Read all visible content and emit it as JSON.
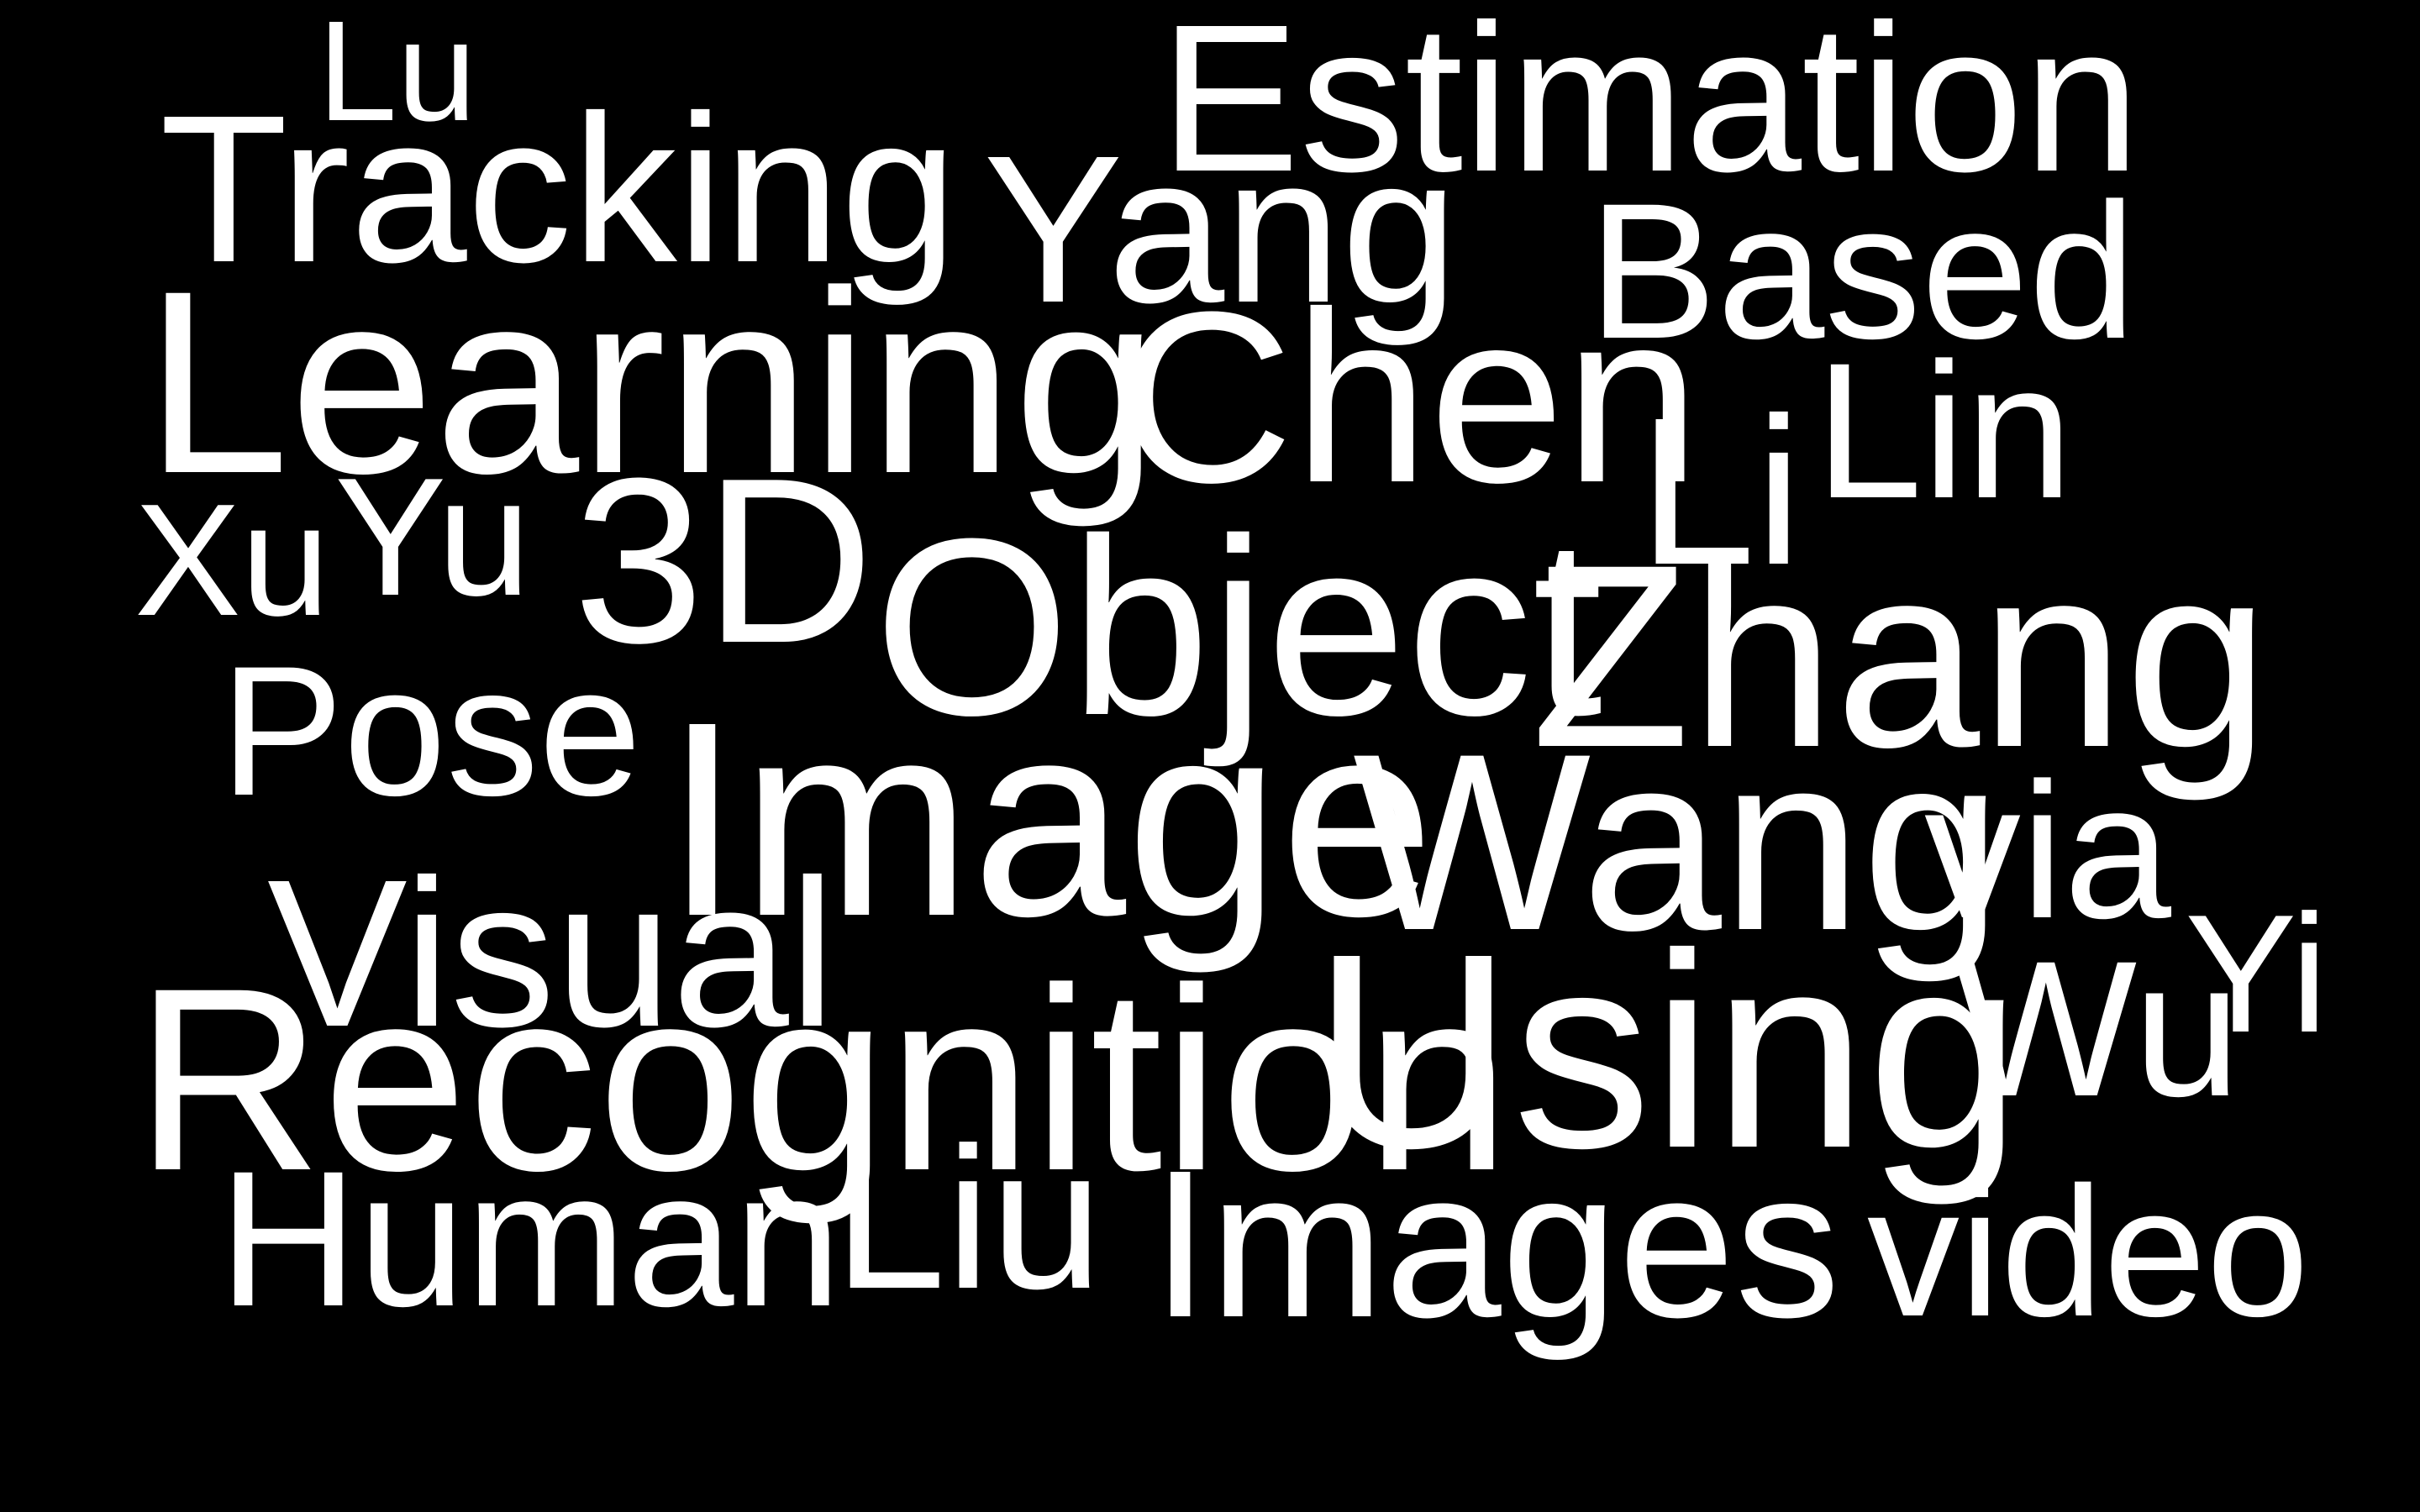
{
  "background_color": "#000000",
  "text_color": "#ffffff",
  "words": [
    {
      "id": "lu",
      "text": "Lu"
    },
    {
      "id": "estimation",
      "text": "Estimation"
    },
    {
      "id": "tracking",
      "text": "Tracking"
    },
    {
      "id": "yang",
      "text": "Yang"
    },
    {
      "id": "based",
      "text": "Based"
    },
    {
      "id": "learning",
      "text": "Learning"
    },
    {
      "id": "chen",
      "text": "Chen"
    },
    {
      "id": "li",
      "text": "Li"
    },
    {
      "id": "lin",
      "text": "Lin"
    },
    {
      "id": "xu",
      "text": "Xu"
    },
    {
      "id": "yu",
      "text": "Yu"
    },
    {
      "id": "3d",
      "text": "3D"
    },
    {
      "id": "object",
      "text": "Object"
    },
    {
      "id": "zhang",
      "text": "Zhang"
    },
    {
      "id": "pose",
      "text": "Pose"
    },
    {
      "id": "image",
      "text": "Image"
    },
    {
      "id": "wang",
      "text": "Wang"
    },
    {
      "id": "via",
      "text": "via"
    },
    {
      "id": "visual",
      "text": "Visual"
    },
    {
      "id": "yi",
      "text": "Yi"
    },
    {
      "id": "recognition",
      "text": "Recognition"
    },
    {
      "id": "using",
      "text": "Using"
    },
    {
      "id": "wu",
      "text": "Wu"
    },
    {
      "id": "human",
      "text": "Human"
    },
    {
      "id": "liu",
      "text": "Liu"
    },
    {
      "id": "images",
      "text": "Images"
    },
    {
      "id": "video",
      "text": "video"
    }
  ]
}
